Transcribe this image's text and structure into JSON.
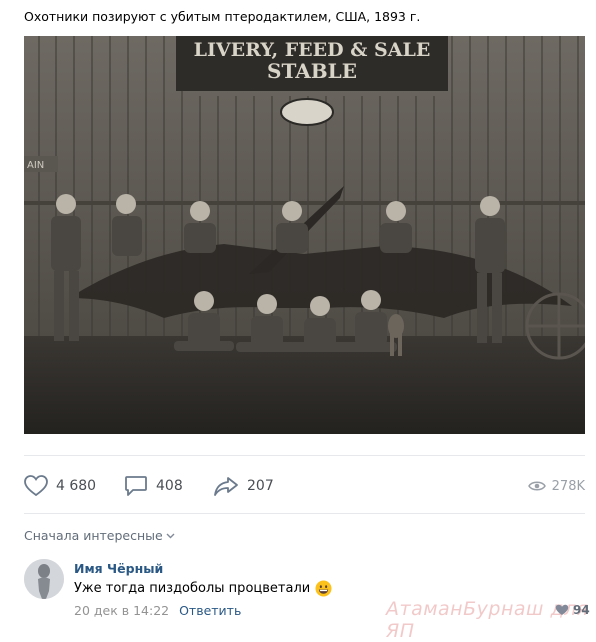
{
  "post": {
    "text": "Охотники позируют с убитым птеродактилем, США, 1893 г.",
    "photo": {
      "sign_line1": "LIVERY, FEED & SALE",
      "sign_line2": "STABLE",
      "side_sign": "AIN"
    }
  },
  "actions": {
    "likes": "4 680",
    "comments": "408",
    "shares": "207",
    "views": "278K"
  },
  "comments": {
    "sort_label": "Сначала интересные",
    "items": [
      {
        "author": "Имя Чёрный",
        "text": "Уже тогда пиздоболы процветали",
        "date": "20 дек в 14:22",
        "reply_label": "Ответить",
        "likes": "94"
      }
    ]
  },
  "watermark": "АтаманБурнаш для ЯП",
  "colors": {
    "link": "#2a5885",
    "muted": "#939393",
    "icon": "#6b7a8c"
  }
}
